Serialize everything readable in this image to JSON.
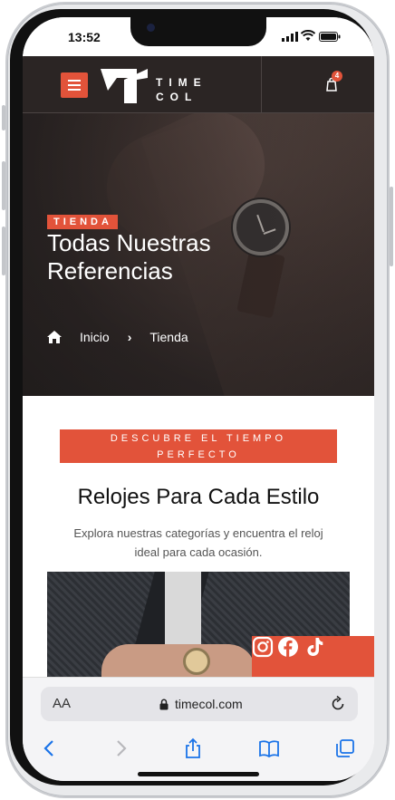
{
  "status_bar": {
    "time": "13:52"
  },
  "header": {
    "menu_icon": "hamburger-menu-icon",
    "logo_mark": "T",
    "logo_line1": "TIME",
    "logo_line2": "COL",
    "cart_count": "4",
    "cart_icon": "shopping-bag-icon",
    "accent": "#e2533a"
  },
  "hero": {
    "tag": "TIENDA",
    "title": "Todas Nuestras Referencias",
    "breadcrumb": {
      "home_icon": "home-icon",
      "home": "Inicio",
      "separator": "›",
      "current": "Tienda"
    }
  },
  "section": {
    "eyebrow_line1": "DESCUBRE EL TIEMPO",
    "eyebrow_line2": "PERFECTO",
    "title": "Relojes Para Cada Estilo",
    "description": "Explora nuestras categorías y encuentra el reloj ideal para cada ocasión."
  },
  "social": {
    "icons": [
      "instagram-icon",
      "facebook-icon",
      "tiktok-icon"
    ]
  },
  "browser": {
    "text_size": "AA",
    "url": "timecol.com",
    "toolbar": [
      "back-icon",
      "forward-icon",
      "share-icon",
      "bookmarks-icon",
      "tabs-icon"
    ]
  }
}
